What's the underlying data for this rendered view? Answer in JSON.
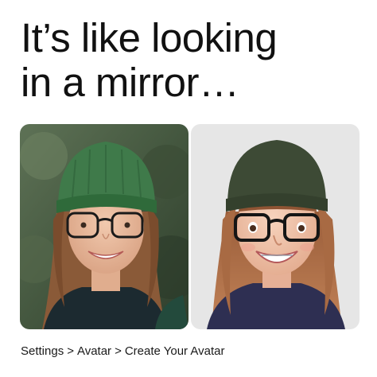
{
  "headline": {
    "line1": "It’s like looking",
    "line2": "in a mirror…"
  },
  "images": {
    "left": {
      "description": "portrait photo"
    },
    "right": {
      "description": "3D avatar"
    }
  },
  "breadcrumb": {
    "items": [
      "Settings",
      "Avatar",
      "Create Your Avatar"
    ],
    "separator": ">"
  },
  "colors": {
    "beanie_photo": "#3f7a4a",
    "beanie_avatar": "#3d4a35",
    "hair": "#8a5a38",
    "background_avatar": "#e6e6e6"
  }
}
